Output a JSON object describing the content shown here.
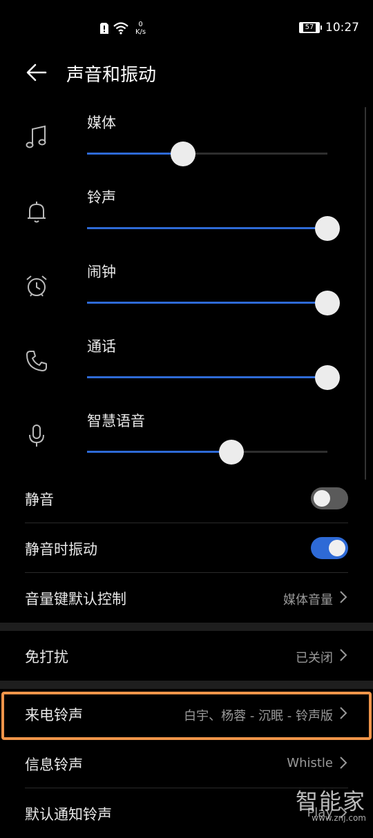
{
  "status_bar": {
    "net_speed_value": "0",
    "net_speed_unit": "K/s",
    "battery_level": "57",
    "time": "10:27"
  },
  "header": {
    "title": "声音和振动"
  },
  "volumes": [
    {
      "label": "媒体",
      "icon": "music-note-icon",
      "level": 0.4
    },
    {
      "label": "铃声",
      "icon": "bell-icon",
      "level": 1.0
    },
    {
      "label": "闹钟",
      "icon": "alarm-clock-icon",
      "level": 1.0
    },
    {
      "label": "通话",
      "icon": "phone-icon",
      "level": 1.0
    },
    {
      "label": "智慧语音",
      "icon": "microphone-icon",
      "level": 0.6
    }
  ],
  "settings": {
    "mute": {
      "label": "静音",
      "enabled": false
    },
    "vibrate_when_muted": {
      "label": "静音时振动",
      "enabled": true
    },
    "volume_key_default": {
      "label": "音量键默认控制",
      "value": "媒体音量"
    },
    "do_not_disturb": {
      "label": "免打扰",
      "value": "已关闭"
    },
    "ringtone": {
      "label": "来电铃声",
      "value": "白宇、杨蓉 - 沉眠 - 铃声版"
    },
    "message_tone": {
      "label": "信息铃声",
      "value": "Whistle"
    },
    "notification_tone": {
      "label": "默认通知铃声",
      "value": "Play"
    }
  },
  "colors": {
    "accent": "#2e6ad6",
    "highlight_border": "#f0954a"
  },
  "watermark": {
    "text": "智能家",
    "url_text": "www.znj.com"
  }
}
